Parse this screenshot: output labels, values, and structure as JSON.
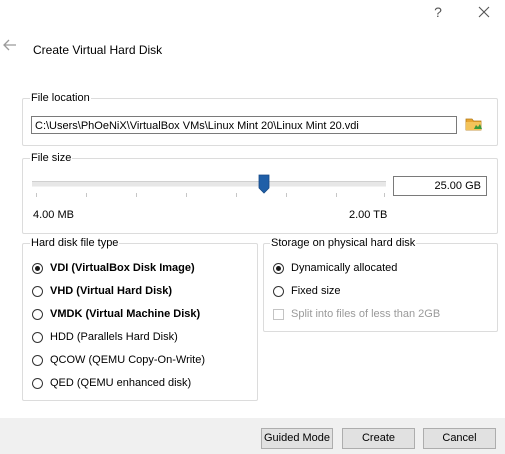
{
  "titlebar": {
    "help_label": "?"
  },
  "dialog": {
    "title": "Create Virtual Hard Disk"
  },
  "file_location": {
    "group_label": "File location",
    "path_value": "C:\\Users\\PhOeNiX\\VirtualBox VMs\\Linux Mint 20\\Linux Mint 20.vdi"
  },
  "file_size": {
    "group_label": "File size",
    "value": "25.00 GB",
    "min_label": "4.00 MB",
    "max_label": "2.00 TB",
    "slider_level_percent": 65
  },
  "disk_type": {
    "group_label": "Hard disk file type",
    "options": [
      {
        "label": "VDI (VirtualBox Disk Image)",
        "selected": true,
        "bold": true
      },
      {
        "label": "VHD (Virtual Hard Disk)",
        "selected": false,
        "bold": true
      },
      {
        "label": "VMDK (Virtual Machine Disk)",
        "selected": false,
        "bold": true
      },
      {
        "label": "HDD (Parallels Hard Disk)",
        "selected": false,
        "bold": false
      },
      {
        "label": "QCOW (QEMU Copy-On-Write)",
        "selected": false,
        "bold": false
      },
      {
        "label": "QED (QEMU enhanced disk)",
        "selected": false,
        "bold": false
      }
    ]
  },
  "storage": {
    "group_label": "Storage on physical hard disk",
    "options": [
      {
        "label": "Dynamically allocated",
        "selected": true
      },
      {
        "label": "Fixed size",
        "selected": false
      }
    ],
    "split_label": "Split into files of less than 2GB",
    "split_checked": false,
    "split_enabled": false
  },
  "buttons": {
    "guided_mode": "Guided Mode",
    "create": "Create",
    "cancel": "Cancel"
  },
  "colors": {
    "slider_thumb": "#1f5fa8",
    "folder_icon": "#e8a531",
    "footer_bg": "#f0f0f0"
  }
}
